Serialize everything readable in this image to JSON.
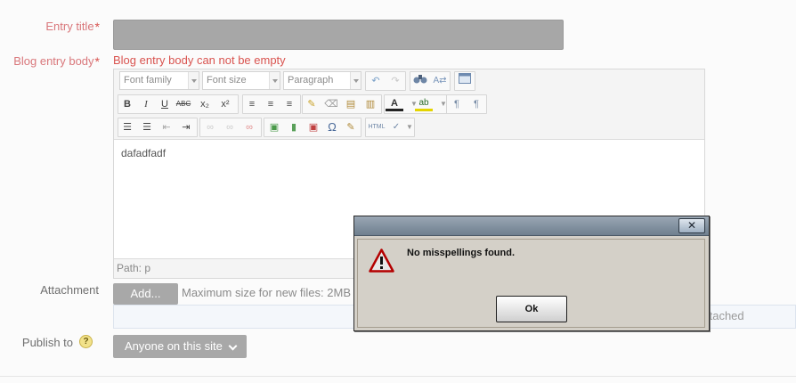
{
  "form": {
    "entry_title_label": "Entry title",
    "blog_body_label": "Blog entry body",
    "required_mark": "*",
    "body_error": "Blog entry body can not be empty",
    "attachment_label": "Attachment",
    "add_button": "Add...",
    "max_size_text": "Maximum size for new files: 2MB",
    "attached_text": "ttached",
    "publish_label": "Publish to",
    "help_icon": "?",
    "publish_value": "Anyone on this site"
  },
  "editor": {
    "font_family": "Font family",
    "font_size": "Font size",
    "format": "Paragraph",
    "content": "dafadfadf",
    "path": "Path: p",
    "toolbar_icons": [
      "undo",
      "redo",
      "find",
      "replace",
      "fullscreen",
      "bold",
      "italic",
      "underline",
      "strikethrough",
      "subscript",
      "superscript",
      "align-left",
      "align-center",
      "align-right",
      "clean",
      "eraser",
      "paste-text",
      "paste-word",
      "text-color",
      "highlight",
      "ltr",
      "rtl",
      "bullet-list",
      "numbered-list",
      "outdent",
      "indent",
      "link",
      "unlink",
      "anchor",
      "image",
      "media",
      "object",
      "special-char",
      "edit",
      "html",
      "spellcheck"
    ],
    "labels": {
      "bold": "B",
      "italic": "I",
      "underline": "U",
      "strike": "ABC",
      "sub": "x₂",
      "sup": "x²",
      "html": "HTML",
      "omega": "Ω"
    }
  },
  "dialog": {
    "close_glyph": "✕",
    "message": "No misspellings found.",
    "ok_button": "Ok"
  },
  "colors": {
    "label_required": "#d9777b",
    "error_text": "#d9534f",
    "button_grey": "#a8a8a8",
    "dialog_bg": "#d4d0c8"
  }
}
